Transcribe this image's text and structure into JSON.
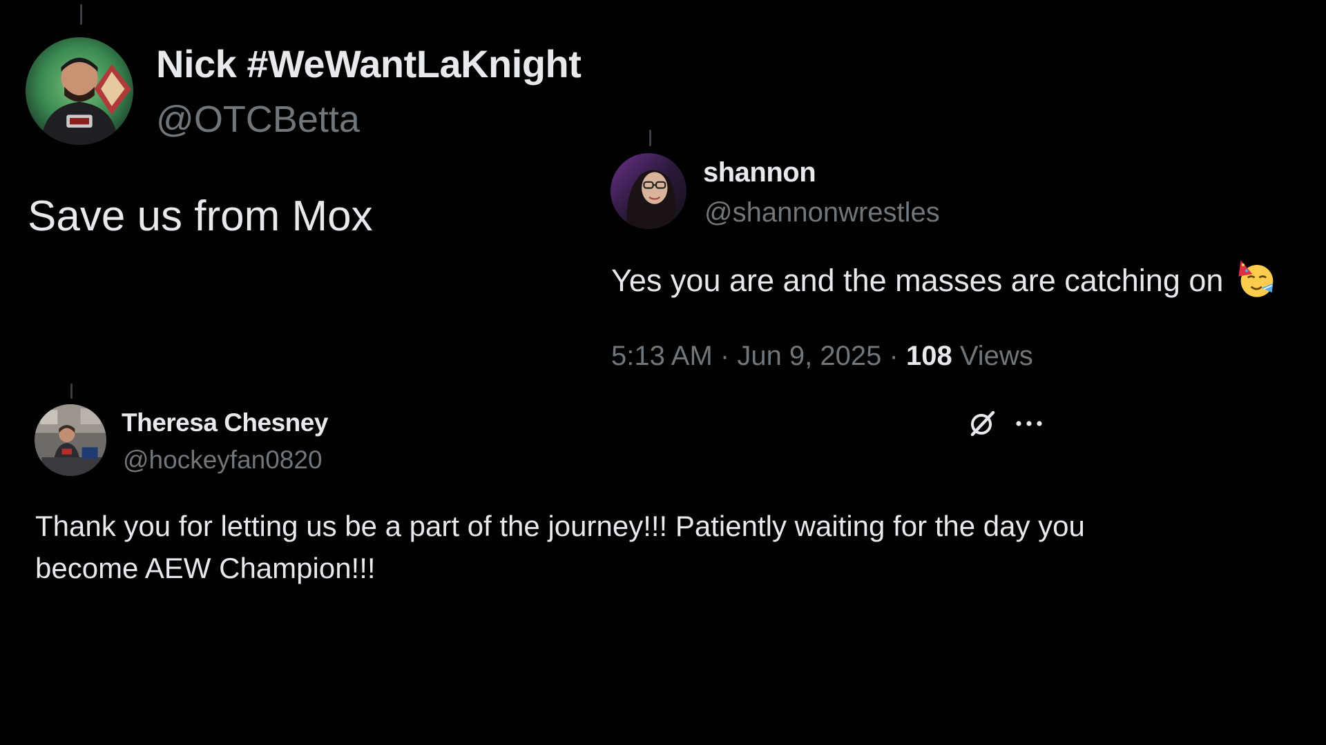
{
  "colors": {
    "background": "#000000",
    "primary_text": "#e7e9ea",
    "secondary_text": "#71767b"
  },
  "tweets": [
    {
      "display_name": "Nick #WeWantLaKnight",
      "handle": "@OTCBetta",
      "text": "Save us from Mox",
      "avatar_icon": "avatar-icon"
    },
    {
      "display_name": "shannon",
      "handle": "@shannonwrestles",
      "text": "Yes you are and the masses are catching on",
      "emoji": "partying-face-emoji",
      "time": "5:13 AM",
      "date": "Jun 9, 2025",
      "views_count": "108",
      "views_label": "Views",
      "avatar_icon": "avatar-icon"
    },
    {
      "display_name": "Theresa Chesney",
      "handle": "@hockeyfan0820",
      "text": "Thank you for letting us be a part of the journey!!!  Patiently waiting for the day you become AEW Champion!!!",
      "avatar_icon": "avatar-icon",
      "actions": [
        "grok-icon",
        "more-icon"
      ]
    }
  ]
}
